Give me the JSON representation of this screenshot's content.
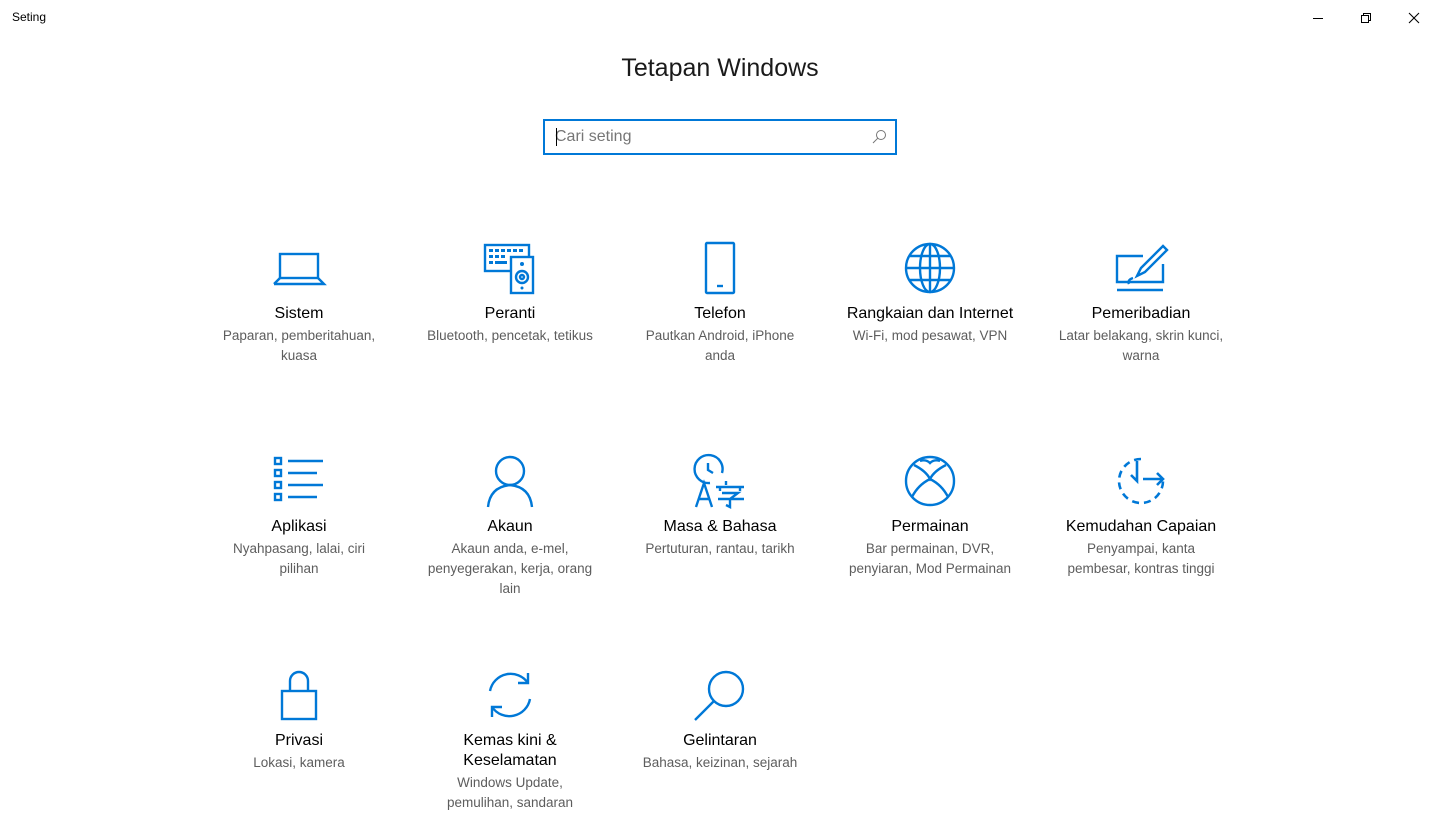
{
  "window": {
    "title": "Seting",
    "minimize_icon": "minimize-icon",
    "maximize_icon": "restore-icon",
    "close_icon": "close-icon"
  },
  "header": {
    "title": "Tetapan Windows"
  },
  "search": {
    "placeholder": "Cari seting",
    "value": "",
    "icon": "search-icon"
  },
  "accent_color": "#0078d7",
  "tiles": [
    {
      "name": "Sistem",
      "desc": "Paparan, pemberitahuan, kuasa",
      "icon": "laptop-icon"
    },
    {
      "name": "Peranti",
      "desc": "Bluetooth, pencetak, tetikus",
      "icon": "devices-icon"
    },
    {
      "name": "Telefon",
      "desc": "Pautkan Android, iPhone anda",
      "icon": "phone-icon"
    },
    {
      "name": "Rangkaian dan Internet",
      "desc": "Wi-Fi, mod pesawat, VPN",
      "icon": "globe-icon"
    },
    {
      "name": "Pemeribadian",
      "desc": "Latar belakang, skrin kunci, warna",
      "icon": "personalization-icon"
    },
    {
      "name": "Aplikasi",
      "desc": "Nyahpasang, lalai, ciri pilihan",
      "icon": "apps-list-icon"
    },
    {
      "name": "Akaun",
      "desc": "Akaun anda, e-mel, penyegerakan, kerja, orang lain",
      "icon": "person-icon"
    },
    {
      "name": "Masa & Bahasa",
      "desc": "Pertuturan, rantau, tarikh",
      "icon": "time-language-icon"
    },
    {
      "name": "Permainan",
      "desc": "Bar permainan, DVR, penyiaran, Mod Permainan",
      "icon": "xbox-icon"
    },
    {
      "name": "Kemudahan Capaian",
      "desc": "Penyampai, kanta pembesar, kontras tinggi",
      "icon": "ease-of-access-icon"
    },
    {
      "name": "Privasi",
      "desc": "Lokasi, kamera",
      "icon": "lock-icon"
    },
    {
      "name": "Kemas kini & Keselamatan",
      "desc": "Windows Update, pemulihan, sandaran",
      "icon": "sync-icon"
    },
    {
      "name": "Gelintaran",
      "desc": "Bahasa, keizinan, sejarah",
      "icon": "magnifier-icon"
    }
  ]
}
